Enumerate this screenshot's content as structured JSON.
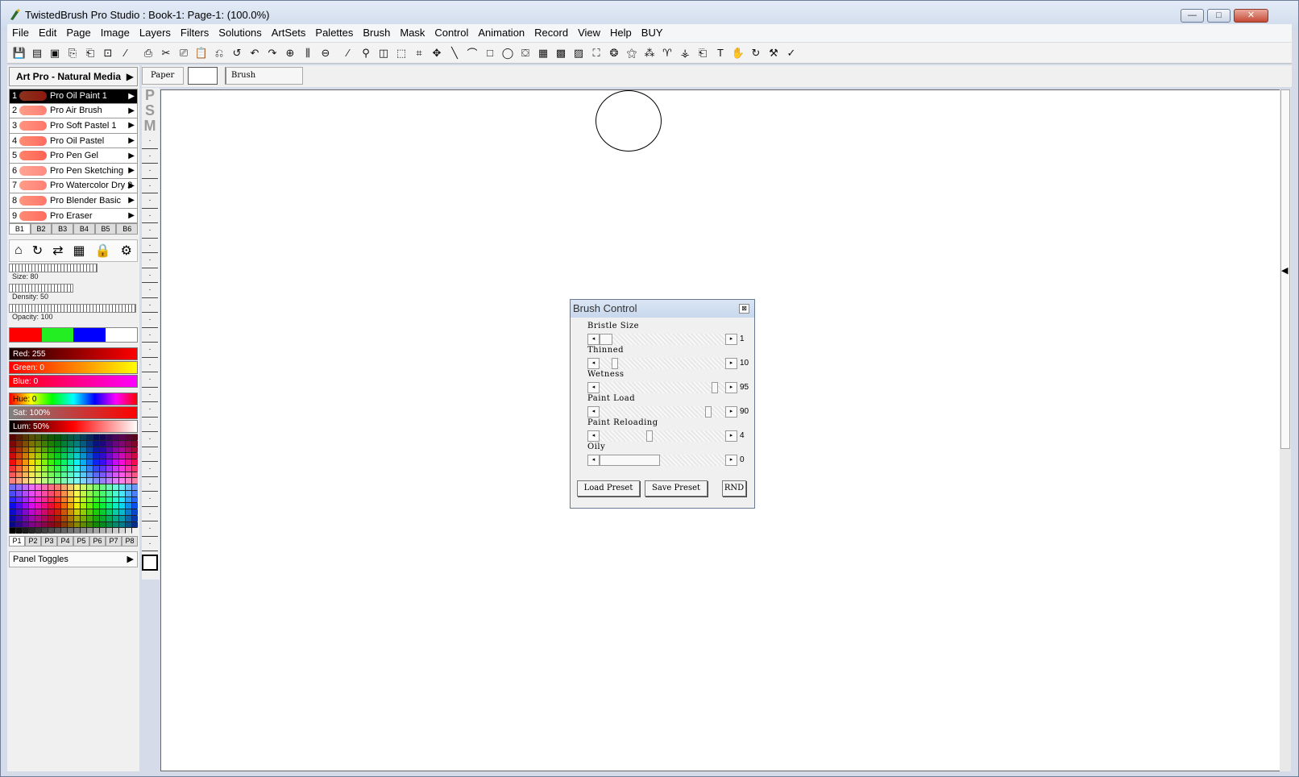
{
  "window": {
    "title": "TwistedBrush Pro Studio : Book-1: Page-1:  (100.0%)",
    "controls": {
      "minimize": "—",
      "maximize": "□",
      "close": "✕"
    }
  },
  "menu": [
    "File",
    "Edit",
    "Page",
    "Image",
    "Layers",
    "Filters",
    "Solutions",
    "ArtSets",
    "Palettes",
    "Brush",
    "Mask",
    "Control",
    "Animation",
    "Record",
    "View",
    "Help",
    "BUY"
  ],
  "toolbar": {
    "icons": [
      "save-icon",
      "save-as-icon",
      "page-icon",
      "page-next-icon",
      "page-prev-icon",
      "page-copy-icon",
      "brush-pen-icon",
      "copy-icon",
      "cut-icon",
      "copy-layer-icon",
      "paste-icon",
      "paste-layer-icon",
      "paste-new-icon",
      "undo-icon",
      "redo-icon",
      "zoom-in-icon",
      "zoom-fit-icon",
      "zoom-out-icon",
      "pencil-icon",
      "eyedropper-icon",
      "bucket-icon",
      "select-rect-icon",
      "crop-icon",
      "move-icon",
      "line-icon",
      "lasso-icon",
      "rectangle-icon",
      "ellipse-icon",
      "fill-icon",
      "pattern-icon",
      "grid-icon",
      "pattern2-icon",
      "shape-icon",
      "blob-icon",
      "fx-icon",
      "stamp-icon",
      "spray-icon",
      "tracing-icon",
      "clone-icon",
      "text-icon",
      "hand-icon",
      "rotate-icon",
      "hammer-icon",
      "check-icon"
    ],
    "glyphs": [
      "💾",
      "▤",
      "▣",
      "⎘",
      "⎗",
      "⊡",
      "∕",
      "⎙",
      "✂",
      "⎚",
      "📋",
      "⎌",
      "↺",
      "↶",
      "↷",
      "⊕",
      "⫼",
      "⊖",
      "∕",
      "⚲",
      "◫",
      "⬚",
      "⌗",
      "✥",
      "╲",
      "⌒",
      "□",
      "◯",
      "⛋",
      "▦",
      "▩",
      "▨",
      "⛶",
      "❂",
      "⚝",
      "⁂",
      "♈",
      "⚶",
      "⎗",
      "T",
      "✋",
      "↻",
      "⚒",
      "✓"
    ]
  },
  "leftpanel": {
    "artset": "Art Pro - Natural Media",
    "brushes": [
      {
        "num": "1",
        "label": "Pro Oil Paint 1",
        "selected": true
      },
      {
        "num": "2",
        "label": "Pro Air Brush"
      },
      {
        "num": "3",
        "label": "Pro Soft Pastel 1"
      },
      {
        "num": "4",
        "label": "Pro Oil Pastel"
      },
      {
        "num": "5",
        "label": "Pro Pen Gel"
      },
      {
        "num": "6",
        "label": "Pro Pen Sketching"
      },
      {
        "num": "7",
        "label": "Pro Watercolor Dry 2"
      },
      {
        "num": "8",
        "label": "Pro Blender Basic"
      },
      {
        "num": "9",
        "label": "Pro Eraser"
      }
    ],
    "brush_tabs": [
      "B1",
      "B2",
      "B3",
      "B4",
      "B5",
      "B6"
    ],
    "sliders": [
      {
        "label": "Size: 80",
        "value": 80
      },
      {
        "label": "Density: 50",
        "value": 50
      },
      {
        "label": "Opacity: 100",
        "value": 100
      }
    ],
    "swatch_colors": [
      "#ff0000",
      "#22ee22",
      "#0000ff",
      "#ffffff"
    ],
    "color_bars": [
      {
        "label": "Red: 255"
      },
      {
        "label": "Green: 0"
      },
      {
        "label": "Blue: 0"
      },
      {
        "label": "Hue: 0"
      },
      {
        "label": "Sat: 100%"
      },
      {
        "label": "Lum: 50%"
      }
    ],
    "palette_tabs": [
      "P1",
      "P2",
      "P3",
      "P4",
      "P5",
      "P6",
      "P7",
      "P8"
    ],
    "panel_toggles": "Panel Toggles"
  },
  "layers": {
    "labels": [
      "P",
      "S",
      "M"
    ],
    "dot": "·"
  },
  "paperbar": {
    "paper": "Paper",
    "brush": "Brush"
  },
  "dialog": {
    "title": "Brush Control",
    "close": "⊠",
    "controls": [
      {
        "name": "Bristle Size",
        "value": "1",
        "level": 0.0
      },
      {
        "name": "Thinned",
        "value": "10",
        "level": 0.1
      },
      {
        "name": "Wetness",
        "value": "95",
        "level": 0.95
      },
      {
        "name": "Paint Load",
        "value": "90",
        "level": 0.9
      },
      {
        "name": "Paint Reloading",
        "value": "4",
        "level": 0.4
      },
      {
        "name": "Oily",
        "value": "0",
        "level": 0.0
      }
    ],
    "buttons": {
      "load": "Load Preset",
      "save": "Save Preset",
      "rnd": "RND"
    }
  },
  "arrows": {
    "right": "▶",
    "left": "◀",
    "sm_left": "◂",
    "sm_right": "▸"
  }
}
